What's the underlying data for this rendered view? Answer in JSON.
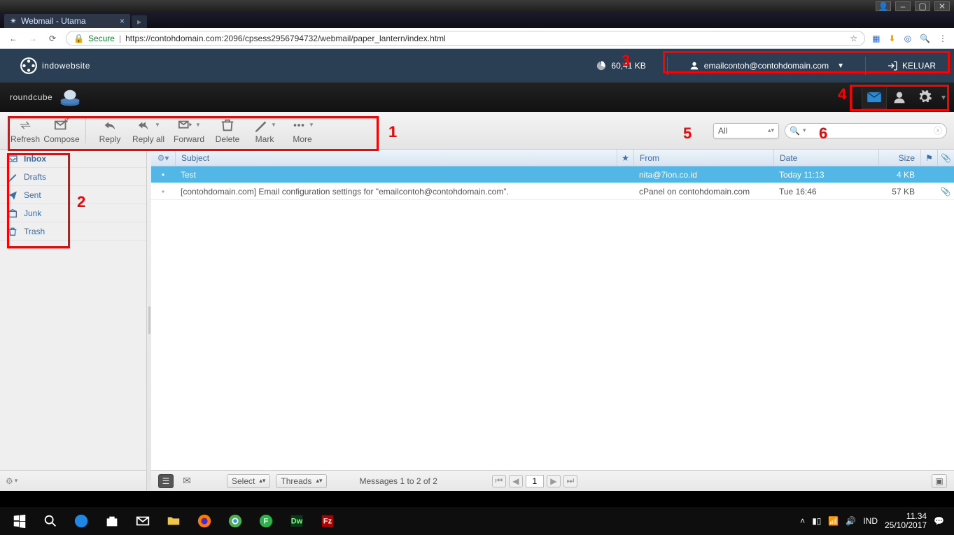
{
  "os_window": {
    "buttons": [
      "user",
      "min",
      "max",
      "close"
    ]
  },
  "browser": {
    "tab_title": "Webmail - Utama",
    "secure_label": "Secure",
    "url": "https://contohdomain.com:2096/cpsess2956794732/webmail/paper_lantern/index.html"
  },
  "cpanel": {
    "brand": "indowebsite",
    "quota": "60,41 KB",
    "user_email": "emailcontoh@contohdomain.com",
    "logout_label": "KELUAR"
  },
  "roundcube": {
    "logo_text": "roundcube"
  },
  "toolbar": {
    "refresh": "Refresh",
    "compose": "Compose",
    "reply": "Reply",
    "reply_all": "Reply all",
    "forward": "Forward",
    "delete": "Delete",
    "mark": "Mark",
    "more": "More"
  },
  "filter": {
    "label": "All"
  },
  "folders": {
    "inbox": "Inbox",
    "drafts": "Drafts",
    "sent": "Sent",
    "junk": "Junk",
    "trash": "Trash"
  },
  "columns": {
    "subject": "Subject",
    "from": "From",
    "date": "Date",
    "size": "Size"
  },
  "messages": [
    {
      "subject": "Test",
      "from": "nita@7ion.co.id",
      "date": "Today 11:13",
      "size": "4 KB",
      "selected": true,
      "attachment": false
    },
    {
      "subject": "[contohdomain.com] Email configuration settings for \"emailcontoh@contohdomain.com\".",
      "from": "cPanel on contohdomain.com",
      "date": "Tue 16:46",
      "size": "57 KB",
      "selected": false,
      "attachment": true
    }
  ],
  "statusbar": {
    "select_label": "Select",
    "threads_label": "Threads",
    "count_text": "Messages 1 to 2 of 2",
    "page": "1"
  },
  "annotations": {
    "n1": "1",
    "n2": "2",
    "n3": "3",
    "n4": "4",
    "n5": "5",
    "n6": "6"
  },
  "tray": {
    "lang": "IND",
    "time": "11.34",
    "date": "25/10/2017"
  }
}
